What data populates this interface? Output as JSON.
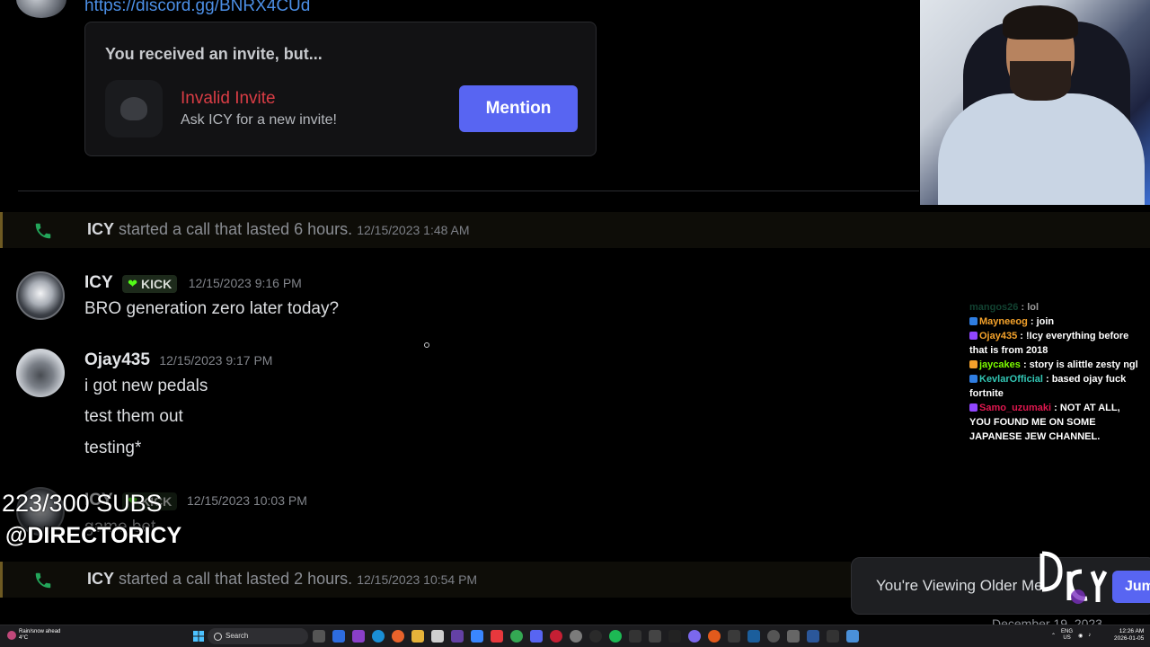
{
  "invite_link": "https://discord.gg/BNRX4CUd",
  "invite_card": {
    "heading": "You received an invite, but...",
    "title": "Invalid Invite",
    "subtitle": "Ask ICY for a new invite!",
    "button_label": "Mention"
  },
  "calls": [
    {
      "name": "ICY",
      "text": "started a call that lasted 6 hours.",
      "timestamp": "12/15/2023 1:48 AM"
    },
    {
      "name": "ICY",
      "text": "started a call that lasted 2 hours.",
      "timestamp": "12/15/2023 10:54 PM"
    }
  ],
  "messages": [
    {
      "author": "ICY",
      "badge": "KICK",
      "timestamp": "12/15/2023 9:16 PM",
      "lines": [
        "BRO generation zero later today?"
      ]
    },
    {
      "author": "Ojay435",
      "timestamp": "12/15/2023 9:17 PM",
      "lines": [
        "i got new pedals",
        "test them out",
        "testing*"
      ]
    },
    {
      "author": "ICY",
      "badge": "KICK",
      "timestamp": "12/15/2023 10:03 PM",
      "lines": [
        "game bet"
      ]
    }
  ],
  "overlay": {
    "subs": "223/300 SUBS",
    "handle": "@DIRECTORICY"
  },
  "twitch_chat": [
    {
      "user": "mangos26",
      "color": "#1e6e52",
      "message": "lol"
    },
    {
      "user": "Mayneeog",
      "color": "#f4a22b",
      "message": "join"
    },
    {
      "user": "Ojay435",
      "color": "#f4a22b",
      "message": "!Icy everything before that is from 2018"
    },
    {
      "user": "jaycakes",
      "color": "#7cfc00",
      "message": "story is alittle zesty ngl"
    },
    {
      "user": "KevlarOfficial",
      "color": "#32c6b4",
      "message": "based ojay fuck fortnite"
    },
    {
      "user": "Samo_uzumaki",
      "color": "#e0174f",
      "message": "NOT AT ALL, YOU FOUND ME ON SOME JAPANESE JEW CHANNEL."
    }
  ],
  "toast": {
    "text": "You're Viewing Older Me",
    "button_label": "Jum"
  },
  "date_separator": "December 19, 2023",
  "taskbar": {
    "weather_line1": "Rain/snow ahead",
    "weather_line2": "4°C",
    "search_placeholder": "Search",
    "lang_line1": "ENG",
    "lang_line2": "US",
    "time": "12:26 AM",
    "date": "2026-01-05"
  },
  "colors": {
    "blurple": "#5865f2",
    "invalid_red": "#da3d45",
    "link_blue": "#4c8fe6",
    "kick_green": "#53fc18",
    "call_green": "#23a55a"
  }
}
